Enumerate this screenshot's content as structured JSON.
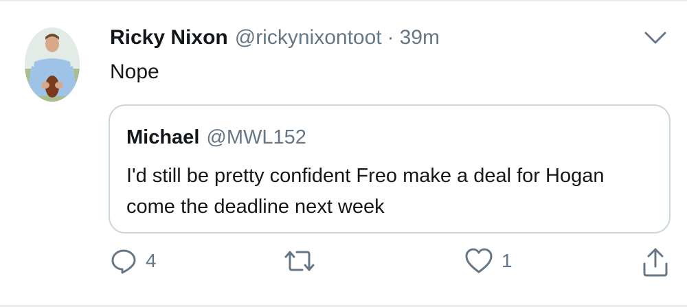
{
  "tweet": {
    "display_name": "Ricky Nixon",
    "handle": "@rickynixontoot",
    "separator": "·",
    "time": "39m",
    "text": "Nope"
  },
  "quoted_tweet": {
    "display_name": "Michael",
    "handle": "@MWL152",
    "text": "I'd still be pretty confident Freo make a deal for Hogan come the deadline next week"
  },
  "actions": {
    "reply_count": "4",
    "like_count": "1"
  },
  "icons": {
    "more": "chevron-down-icon",
    "reply": "reply-icon",
    "retweet": "retweet-icon",
    "like": "heart-icon",
    "share": "share-icon"
  },
  "colors": {
    "text": "#14171a",
    "secondary": "#657786",
    "border": "#ccd6dd",
    "icon": "#657786"
  }
}
